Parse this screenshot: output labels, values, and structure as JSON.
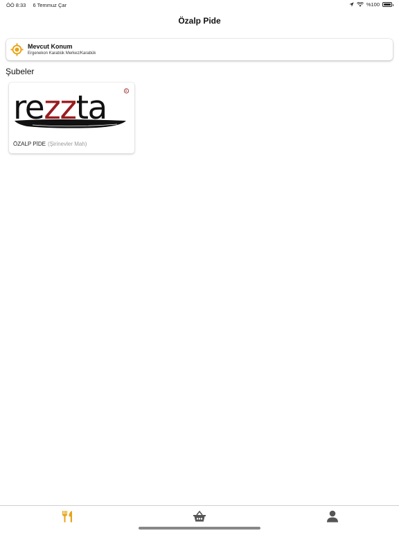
{
  "status_bar": {
    "time": "ÖÖ 8:33",
    "date": "6 Temmuz Çar",
    "battery": "%100",
    "battery_level": 1.0
  },
  "header": {
    "title": "Özalp Pide"
  },
  "location": {
    "title": "Mevcut Konum",
    "address": "Ergenekon Karabük Merkez/Karabük",
    "icon": "location-target-icon"
  },
  "branches_section": {
    "title": "Şubeler",
    "branches": [
      {
        "logo_text": "rezzta",
        "name": "ÖZALP PİDE",
        "district": "(Şirinevler Mah)"
      }
    ]
  },
  "tab_bar": {
    "tabs": [
      {
        "icon": "fork-knife-icon",
        "active": true
      },
      {
        "icon": "basket-icon",
        "active": false
      },
      {
        "icon": "person-icon",
        "active": false
      }
    ],
    "active_color": "#e8a317",
    "inactive_color": "#555555"
  },
  "colors": {
    "accent": "#e8a317",
    "logo_red": "#9a1c1f"
  }
}
